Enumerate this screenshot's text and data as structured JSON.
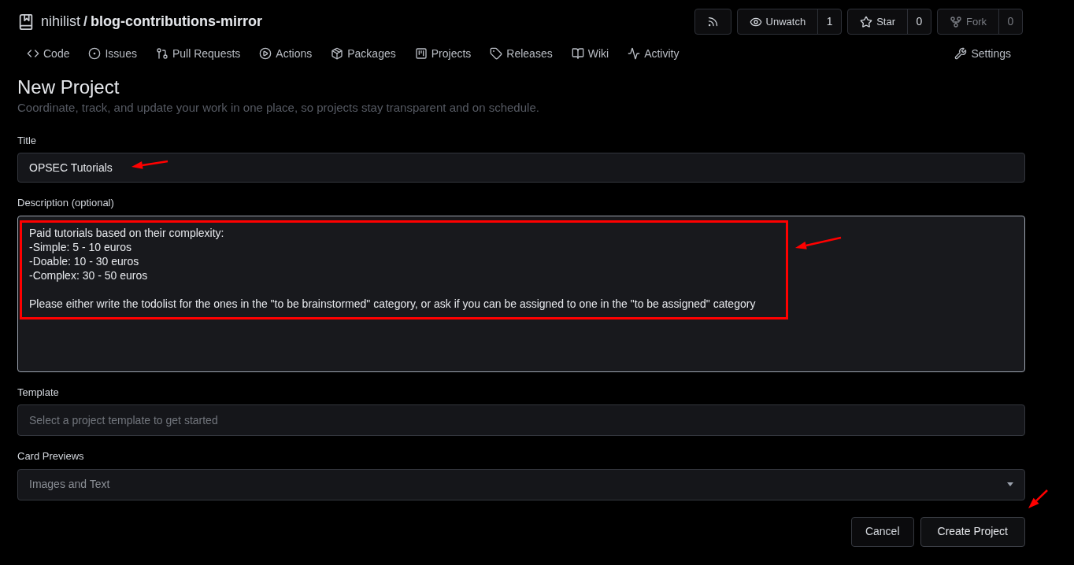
{
  "repo": {
    "owner": "nihilist",
    "separator": "/",
    "name": "blog-contributions-mirror"
  },
  "header_buttons": [
    {
      "kind": "rss"
    },
    {
      "kind": "watch",
      "label": "Unwatch",
      "count": "1",
      "disabled": false
    },
    {
      "kind": "star",
      "label": "Star",
      "count": "0",
      "disabled": false
    },
    {
      "kind": "fork",
      "label": "Fork",
      "count": "0",
      "disabled": true
    }
  ],
  "nav": [
    {
      "kind": "code",
      "label": "Code"
    },
    {
      "kind": "issues",
      "label": "Issues"
    },
    {
      "kind": "pulls",
      "label": "Pull Requests"
    },
    {
      "kind": "actions",
      "label": "Actions"
    },
    {
      "kind": "packages",
      "label": "Packages"
    },
    {
      "kind": "projects",
      "label": "Projects"
    },
    {
      "kind": "releases",
      "label": "Releases"
    },
    {
      "kind": "wiki",
      "label": "Wiki"
    },
    {
      "kind": "activity",
      "label": "Activity"
    }
  ],
  "settings": {
    "label": "Settings"
  },
  "page": {
    "title": "New Project",
    "subtitle": "Coordinate, track, and update your work in one place, so projects stay transparent and on schedule."
  },
  "form": {
    "title": {
      "label": "Title",
      "value": "OPSEC Tutorials"
    },
    "description": {
      "label": "Description (optional)",
      "value": "Paid tutorials based on their complexity:\n-Simple: 5 - 10 euros\n-Doable: 10 - 30 euros\n-Complex: 30 - 50 euros\n\nPlease either write the todolist for the ones in the \"to be brainstormed\" category, or ask if you can be assigned to one in the \"to be assigned\" category"
    },
    "template": {
      "label": "Template",
      "placeholder": "Select a project template to get started"
    },
    "card_previews": {
      "label": "Card Previews",
      "value": "Images and Text"
    }
  },
  "actions": [
    {
      "kind": "secondary",
      "label": "Cancel"
    },
    {
      "kind": "primary",
      "label": "Create Project"
    }
  ]
}
